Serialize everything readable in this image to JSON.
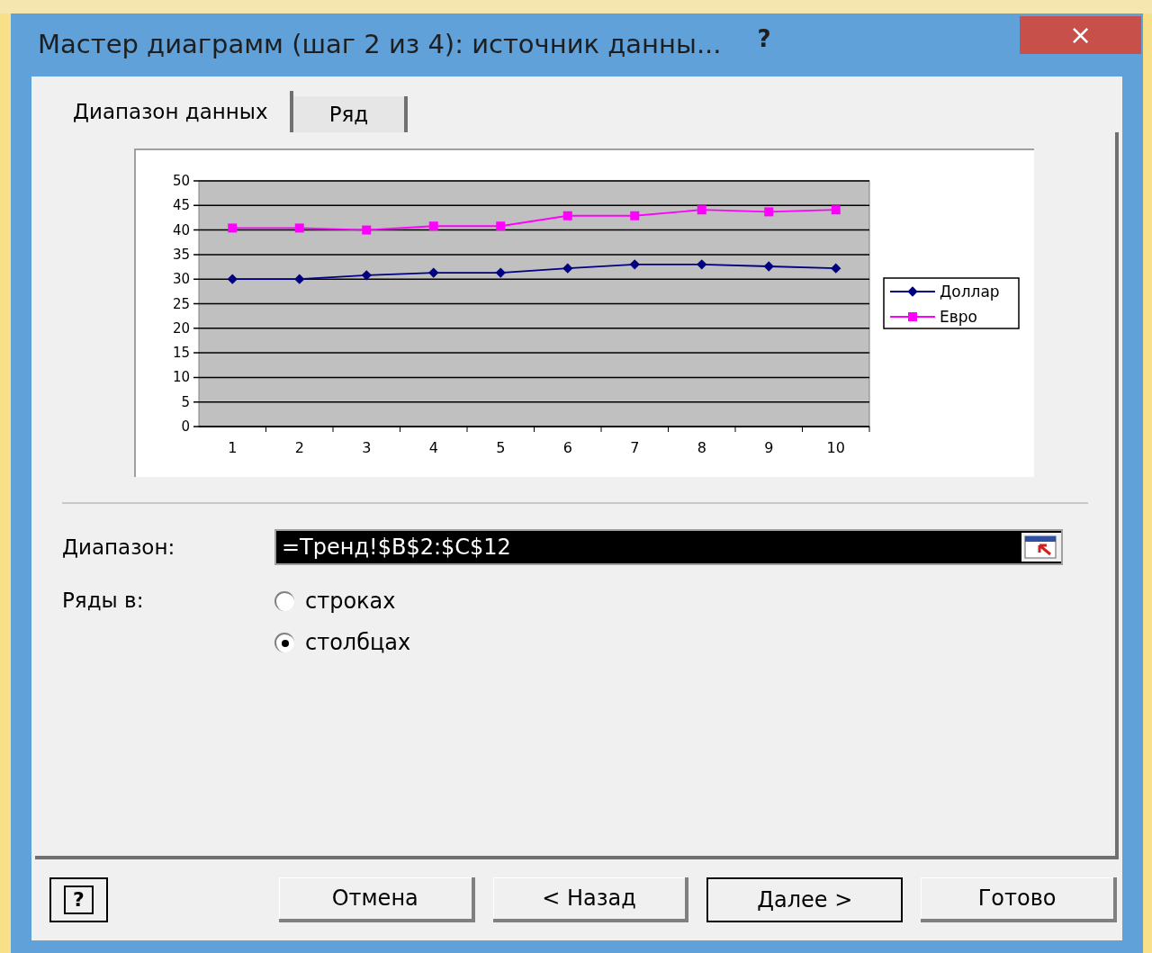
{
  "window": {
    "title": "Мастер диаграмм (шаг 2 из 4): источник данны...",
    "help": "?",
    "close": "×"
  },
  "tabs": [
    {
      "label": "Диапазон данных",
      "selected": true
    },
    {
      "label": "Ряд",
      "selected": false
    }
  ],
  "chart_data": {
    "type": "line",
    "categories": [
      "1",
      "2",
      "3",
      "4",
      "5",
      "6",
      "7",
      "8",
      "9",
      "10"
    ],
    "yticks": [
      0,
      5,
      10,
      15,
      20,
      25,
      30,
      35,
      40,
      45,
      50
    ],
    "ylim": [
      0,
      50
    ],
    "grid": true,
    "legend": true,
    "series": [
      {
        "name": "Доллар",
        "color": "#000080",
        "marker": "diamond",
        "values": [
          30,
          30,
          30.8,
          31.3,
          31.3,
          32.2,
          33,
          33,
          32.6,
          32.2
        ]
      },
      {
        "name": "Евро",
        "color": "#ff00ff",
        "marker": "square",
        "values": [
          40.4,
          40.4,
          40,
          40.8,
          40.8,
          42.9,
          42.9,
          44.1,
          43.7,
          44.1
        ]
      }
    ]
  },
  "range": {
    "label": "Диапазон:",
    "value": "=Тренд!$B$2:$C$12"
  },
  "series_in": {
    "label": "Ряды в:",
    "options": [
      {
        "label": "строках",
        "selected": false
      },
      {
        "label": "столбцах",
        "selected": true
      }
    ]
  },
  "buttons": [
    {
      "kind": "help",
      "label": "?"
    },
    {
      "kind": "text",
      "label": "Отмена",
      "default": false
    },
    {
      "kind": "text",
      "label": "< Назад",
      "default": false
    },
    {
      "kind": "text",
      "label": "Далее >",
      "default": true
    },
    {
      "kind": "text",
      "label": "Готово",
      "default": false
    }
  ]
}
